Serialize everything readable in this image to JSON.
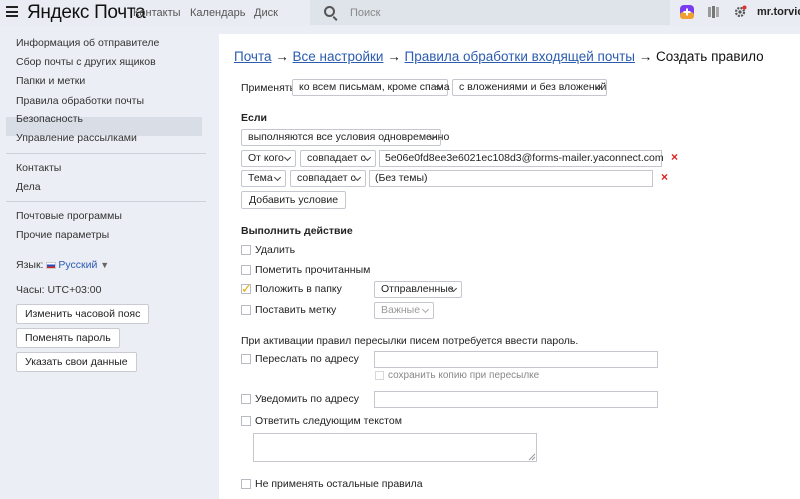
{
  "header": {
    "logo": "Яндекс Почта",
    "nav": [
      "Контакты",
      "Календарь",
      "Диск"
    ],
    "search_placeholder": "Поиск",
    "username": "mr.torvic"
  },
  "sidebar": {
    "settings_items": [
      "Информация об отправителе",
      "Сбор почты с других ящиков",
      "Папки и метки",
      "Правила обработки почты",
      "Безопасность",
      "Управление рассылками"
    ],
    "links": [
      "Контакты",
      "Дела"
    ],
    "other_items": [
      "Почтовые программы",
      "Прочие параметры"
    ],
    "language_label": "Язык:",
    "language_value": "Русский",
    "timezone_label": "Часы:",
    "timezone_value": "UTC+03:00",
    "buttons": [
      "Изменить часовой пояс",
      "Поменять пароль",
      "Указать свои данные"
    ]
  },
  "breadcrumb": {
    "items": [
      "Почта",
      "Все настройки",
      "Правила обработки входящей почты"
    ],
    "current": "Создать правило",
    "separator": "→"
  },
  "apply": {
    "label": "Применять",
    "scope": "ко всем письмам, кроме спама",
    "attachments": "с вложениями и без вложений"
  },
  "conditions": {
    "heading": "Если",
    "mode": "выполняются все условия одновременно",
    "rows": [
      {
        "field": "От кого",
        "op": "совпадает с",
        "value": "5e06e0fd8ee3e6021ec108d3@forms-mailer.yaconnect.com"
      },
      {
        "field": "Тема",
        "op": "совпадает с",
        "value": "(Без темы)"
      }
    ],
    "add_button": "Добавить условие"
  },
  "actions": {
    "heading": "Выполнить действие",
    "delete": "Удалить",
    "mark_read": "Пометить прочитанным",
    "move_to_folder": "Положить в папку",
    "folder_value": "Отправленные",
    "set_label": "Поставить метку",
    "label_value": "Важные",
    "password_note": "При активации правил пересылки писем потребуется ввести пароль.",
    "forward": "Переслать по адресу",
    "keep_copy": "сохранить копию при пересылке",
    "notify": "Уведомить по адресу",
    "reply": "Ответить следующим текстом",
    "stop": "Не применять остальные правила"
  },
  "colors": {
    "link": "#2b5cb0",
    "check": "#e8a800",
    "remove": "#e02020"
  }
}
